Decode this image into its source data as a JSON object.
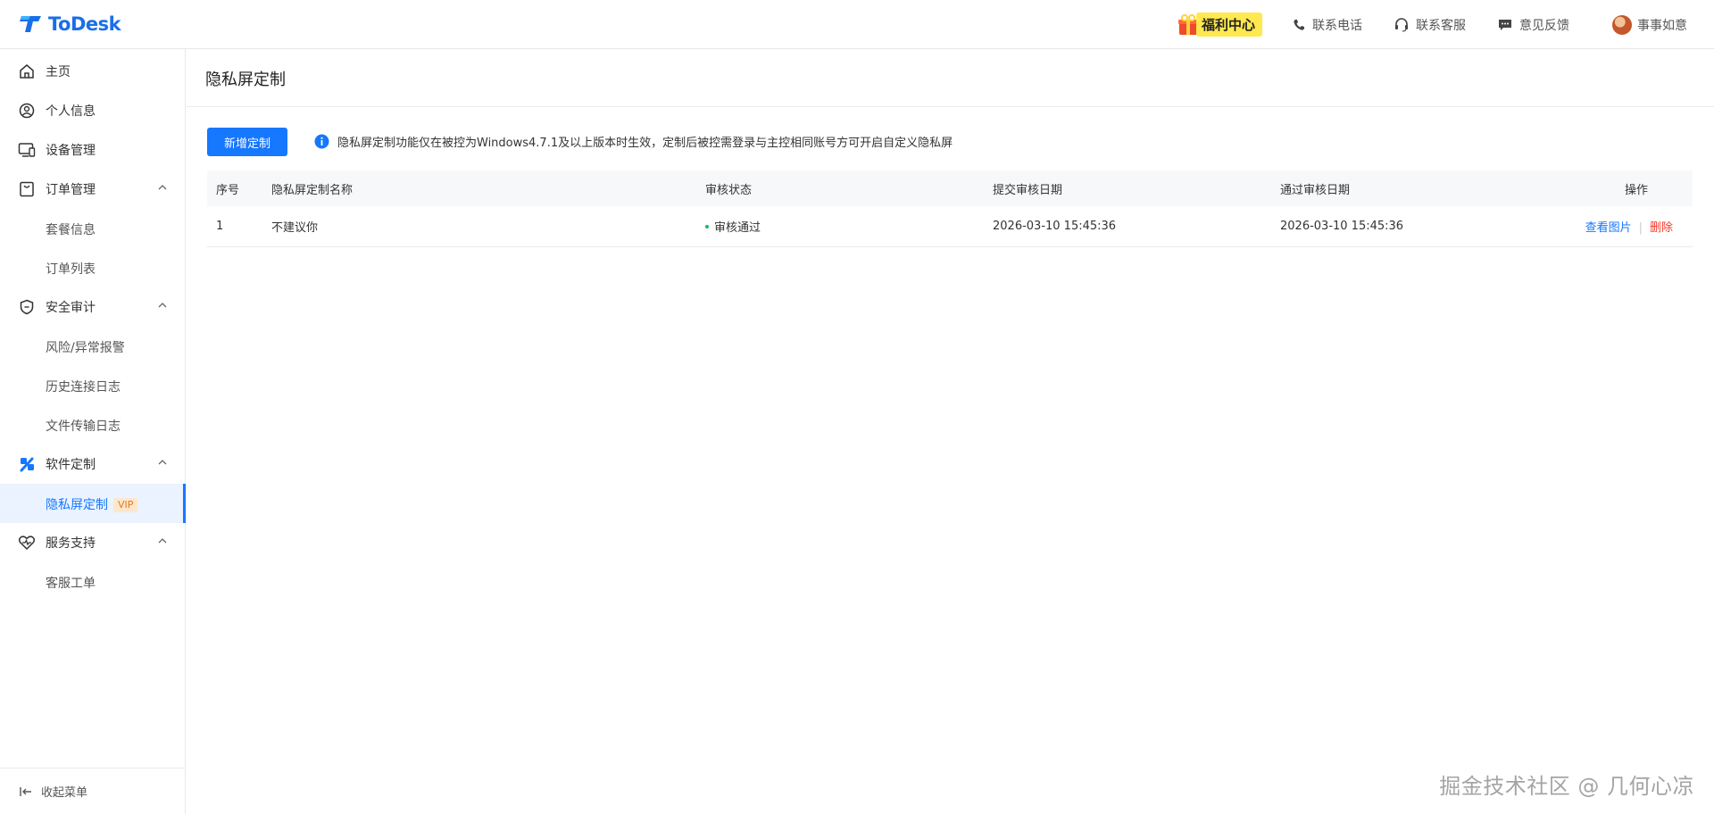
{
  "header": {
    "logo_text": "ToDesk",
    "gift_label": "福利中心",
    "phone_label": "联系电话",
    "service_label": "联系客服",
    "feedback_label": "意见反馈",
    "user_name": "事事如意"
  },
  "sidebar": {
    "home": "主页",
    "profile": "个人信息",
    "devices": "设备管理",
    "orders": "订单管理",
    "orders_sub": [
      "套餐信息",
      "订单列表"
    ],
    "audit": "安全审计",
    "audit_sub": [
      "风险/异常报警",
      "历史连接日志",
      "文件传输日志"
    ],
    "custom": "软件定制",
    "custom_sub": "隐私屏定制",
    "vip": "VIP",
    "support": "服务支持",
    "support_sub": "客服工单",
    "collapse": "收起菜单"
  },
  "main": {
    "title": "隐私屏定制",
    "add_button": "新增定制",
    "notice": "隐私屏定制功能仅在被控为Windows4.7.1及以上版本时生效，定制后被控需登录与主控相同账号方可开启自定义隐私屏",
    "table": {
      "headers": [
        "序号",
        "隐私屏定制名称",
        "审核状态",
        "提交审核日期",
        "通过审核日期",
        "操作"
      ],
      "rows": [
        {
          "index": "1",
          "name": "不建议你",
          "status": "审核通过",
          "submitted": "2026-03-10 15:45:36",
          "approved": "2026-03-10 15:45:36",
          "view": "查看图片",
          "sep": "|",
          "delete": "删除"
        }
      ]
    }
  },
  "watermark": "掘金技术社区 @ 几何心凉",
  "colors": {
    "primary": "#1677ff",
    "danger": "#f5382b",
    "success": "#1db66a",
    "gift_bg": "#ffe94f"
  }
}
